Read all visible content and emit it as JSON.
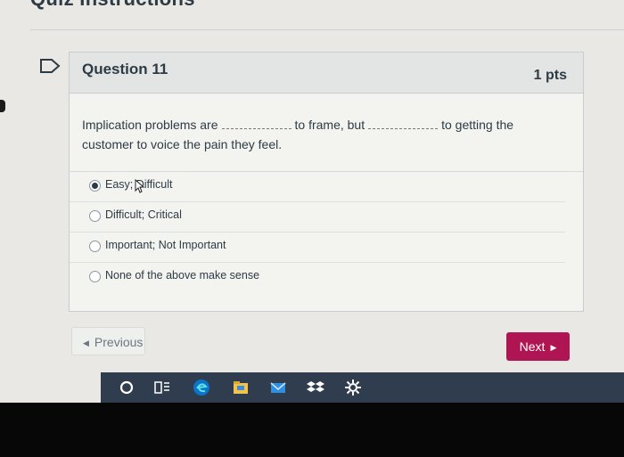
{
  "page": {
    "title": "Quiz Instructions"
  },
  "question": {
    "name": "Question 11",
    "points": "1 pts",
    "text_part1": "Implication problems are",
    "text_part2": "to frame, but",
    "text_part3": "to getting the customer to voice the pain they feel."
  },
  "answers": [
    {
      "label": "Easy; Difficult",
      "selected": true
    },
    {
      "label": "Difficult; Critical",
      "selected": false
    },
    {
      "label": "Important; Not Important",
      "selected": false
    },
    {
      "label": "None of the above make sense",
      "selected": false
    }
  ],
  "nav": {
    "previous_label": "Previous",
    "next_label": "Next"
  },
  "colors": {
    "next_button": "#b01553",
    "taskbar": "#2f3d4e",
    "accent_blue": "#0a74c9"
  },
  "taskbar_icons": [
    "search-circle-icon",
    "task-view-icon",
    "edge-browser-icon",
    "file-explorer-icon",
    "mail-icon",
    "dropbox-icon",
    "settings-gear-icon"
  ]
}
